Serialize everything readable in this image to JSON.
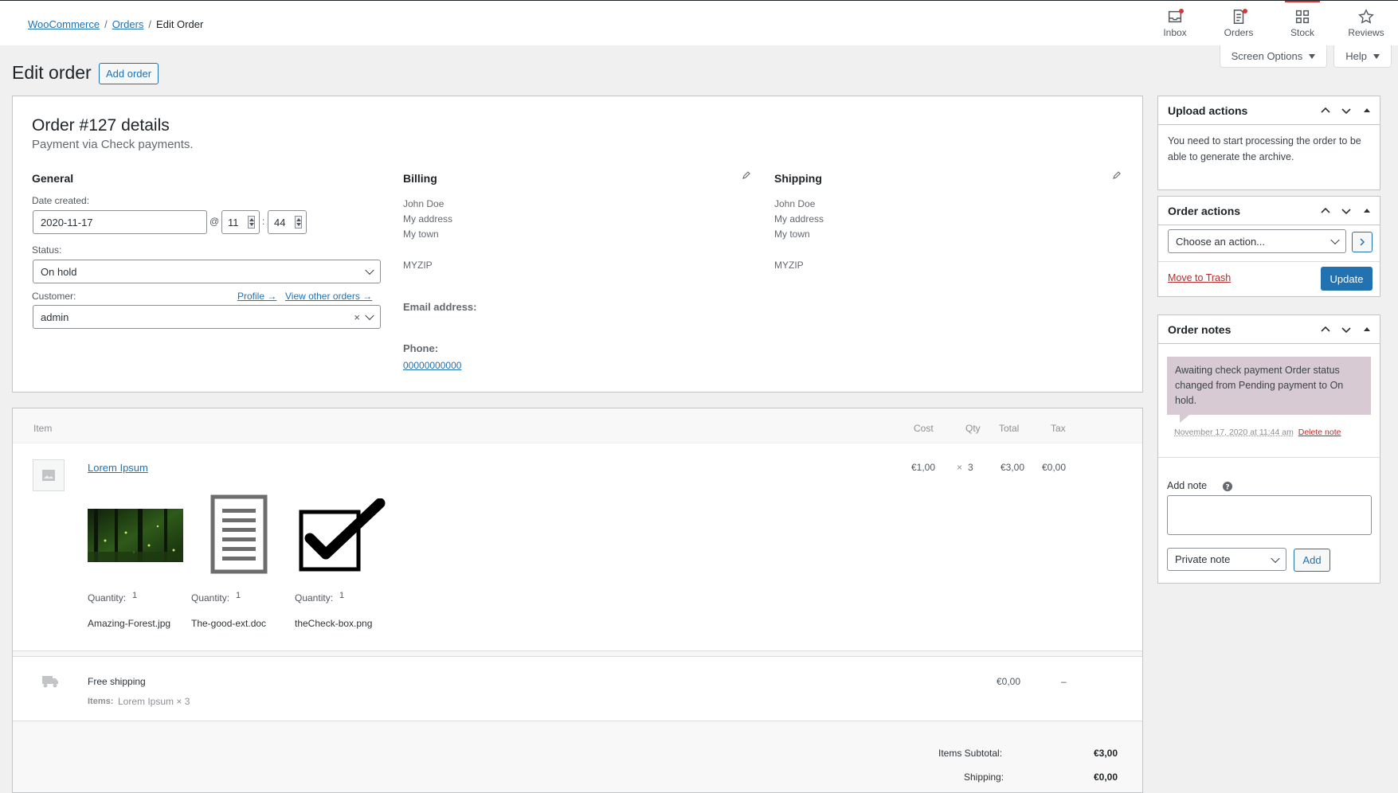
{
  "breadcrumb": {
    "root": "WooCommerce",
    "sep": "/",
    "parent": "Orders",
    "current": "Edit Order"
  },
  "topnav": {
    "inbox": "Inbox",
    "orders": "Orders",
    "stock": "Stock",
    "reviews": "Reviews"
  },
  "screen_options": {
    "label": "Screen Options",
    "help": "Help"
  },
  "page": {
    "title": "Edit order",
    "add_order": "Add order"
  },
  "order": {
    "title": "Order #127 details",
    "subtitle": "Payment via Check payments.",
    "general": {
      "heading": "General",
      "date_label": "Date created:",
      "date": "2020-11-17",
      "at": "@",
      "hour": "11",
      "colon": ":",
      "minute": "44",
      "status_label": "Status:",
      "status": "On hold",
      "customer_label": "Customer:",
      "profile_link": "Profile →",
      "other_orders_link": "View other orders →",
      "customer": "admin",
      "clear": "×"
    },
    "billing": {
      "heading": "Billing",
      "name": "John Doe",
      "address": "My address",
      "town": "My town",
      "zip": "MYZIP",
      "email_label": "Email address:",
      "phone_label": "Phone:",
      "phone": "00000000000"
    },
    "shipping": {
      "heading": "Shipping",
      "name": "John Doe",
      "address": "My address",
      "town": "My town",
      "zip": "MYZIP"
    }
  },
  "items": {
    "headers": {
      "item": "Item",
      "cost": "Cost",
      "qty": "Qty",
      "total": "Total",
      "tax": "Tax"
    },
    "line": {
      "name": "Lorem Ipsum",
      "cost": "€1,00",
      "times": "×",
      "qty": "3",
      "total": "€3,00",
      "tax": "€0,00"
    },
    "attachments": [
      {
        "qty_label": "Quantity:",
        "qty": "1",
        "name": "Amazing-Forest.jpg"
      },
      {
        "qty_label": "Quantity:",
        "qty": "1",
        "name": "The-good-ext.doc"
      },
      {
        "qty_label": "Quantity:",
        "qty": "1",
        "name": "theCheck-box.png"
      }
    ],
    "shipping": {
      "name": "Free shipping",
      "items_label": "Items:",
      "items_value": "Lorem Ipsum × 3",
      "total": "€0,00",
      "tax": "–"
    },
    "totals": {
      "subtotal_label": "Items Subtotal:",
      "subtotal": "€3,00",
      "shipping_label": "Shipping:",
      "shipping": "€0,00"
    }
  },
  "sidebar": {
    "upload": {
      "title": "Upload actions",
      "text": "You need to start processing the order to be able to generate the archive."
    },
    "actions": {
      "title": "Order actions",
      "select": "Choose an action...",
      "trash": "Move to Trash",
      "update": "Update"
    },
    "notes": {
      "title": "Order notes",
      "note": "Awaiting check payment Order status changed from Pending payment to On hold.",
      "date": "November 17, 2020 at 11:44 am",
      "delete": "Delete note",
      "add_label": "Add note",
      "note_type": "Private note",
      "add": "Add"
    }
  },
  "colors": {
    "accent": "#2271b1",
    "danger": "#b32d2e",
    "note_bg": "#d7cad2"
  }
}
